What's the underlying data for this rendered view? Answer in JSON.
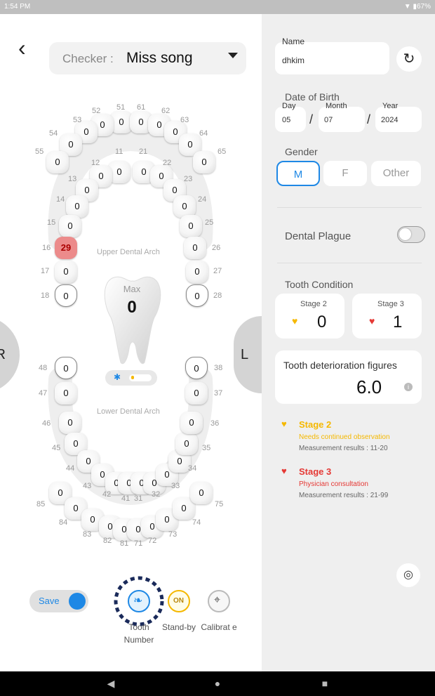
{
  "status": {
    "time": "1:54",
    "ampm": "PM",
    "battery": "67%"
  },
  "checker": {
    "label": "Checker :",
    "value": "Miss song"
  },
  "side_labels": {
    "right": "R",
    "left": "L"
  },
  "arch": {
    "upper": "Upper Dental Arch",
    "lower": "Lower Dental Arch"
  },
  "max": {
    "label": "Max",
    "value": "0"
  },
  "teeth": [
    {
      "num": "51",
      "val": "0"
    },
    {
      "num": "52",
      "val": "0"
    },
    {
      "num": "53",
      "val": "0"
    },
    {
      "num": "54",
      "val": "0"
    },
    {
      "num": "55",
      "val": "0"
    },
    {
      "num": "61",
      "val": "0"
    },
    {
      "num": "62",
      "val": "0"
    },
    {
      "num": "63",
      "val": "0"
    },
    {
      "num": "64",
      "val": "0"
    },
    {
      "num": "65",
      "val": "0"
    },
    {
      "num": "11",
      "val": "0"
    },
    {
      "num": "12",
      "val": "0"
    },
    {
      "num": "13",
      "val": "0"
    },
    {
      "num": "14",
      "val": "0"
    },
    {
      "num": "15",
      "val": "0"
    },
    {
      "num": "16",
      "val": "29"
    },
    {
      "num": "17",
      "val": "0"
    },
    {
      "num": "18",
      "val": "0"
    },
    {
      "num": "21",
      "val": "0"
    },
    {
      "num": "22",
      "val": "0"
    },
    {
      "num": "23",
      "val": "0"
    },
    {
      "num": "24",
      "val": "0"
    },
    {
      "num": "25",
      "val": "0"
    },
    {
      "num": "26",
      "val": "0"
    },
    {
      "num": "27",
      "val": "0"
    },
    {
      "num": "28",
      "val": "0"
    },
    {
      "num": "48",
      "val": "0"
    },
    {
      "num": "47",
      "val": "0"
    },
    {
      "num": "46",
      "val": "0"
    },
    {
      "num": "45",
      "val": "0"
    },
    {
      "num": "44",
      "val": "0"
    },
    {
      "num": "43",
      "val": "0"
    },
    {
      "num": "42",
      "val": "0"
    },
    {
      "num": "41",
      "val": "0"
    },
    {
      "num": "31",
      "val": "0"
    },
    {
      "num": "32",
      "val": "0"
    },
    {
      "num": "33",
      "val": "0"
    },
    {
      "num": "34",
      "val": "0"
    },
    {
      "num": "35",
      "val": "0"
    },
    {
      "num": "36",
      "val": "0"
    },
    {
      "num": "37",
      "val": "0"
    },
    {
      "num": "38",
      "val": "0"
    },
    {
      "num": "85",
      "val": "0"
    },
    {
      "num": "84",
      "val": "0"
    },
    {
      "num": "83",
      "val": "0"
    },
    {
      "num": "82",
      "val": "0"
    },
    {
      "num": "81",
      "val": "0"
    },
    {
      "num": "71",
      "val": "0"
    },
    {
      "num": "72",
      "val": "0"
    },
    {
      "num": "73",
      "val": "0"
    },
    {
      "num": "74",
      "val": "0"
    },
    {
      "num": "75",
      "val": "0"
    }
  ],
  "controls": {
    "save": "Save",
    "tooth_number": "Tooth Number",
    "standby": "Stand-by",
    "calibrate": "Calibrat e",
    "on_badge": "ON"
  },
  "patient": {
    "name_label": "Name",
    "name_value": "dhkim",
    "dob_label": "Date of Birth",
    "day_label": "Day",
    "day_value": "05",
    "month_label": "Month",
    "month_value": "07",
    "year_label": "Year",
    "year_value": "2024",
    "sep": "/",
    "gender_label": "Gender",
    "genders": [
      "M",
      "F",
      "Other"
    ]
  },
  "plaque": {
    "label": "Dental Plague"
  },
  "condition": {
    "label": "Tooth Condition",
    "stage2_label": "Stage 2",
    "stage2_value": "0",
    "stage3_label": "Stage 3",
    "stage3_value": "1"
  },
  "deterioration": {
    "label": "Tooth deterioration figures",
    "value": "6.0"
  },
  "legend": [
    {
      "title": "Stage 2",
      "desc": "Needs continued observation",
      "range": "Measurement results : 11-20",
      "color": "#f5b800"
    },
    {
      "title": "Stage 3",
      "desc": "Physician consultation",
      "range": "Measurement results : 21-99",
      "color": "#e53935"
    }
  ],
  "colors": {
    "accent": "#1e88e5",
    "stage2": "#f5b800",
    "stage3": "#e53935",
    "panel": "#efefef"
  }
}
